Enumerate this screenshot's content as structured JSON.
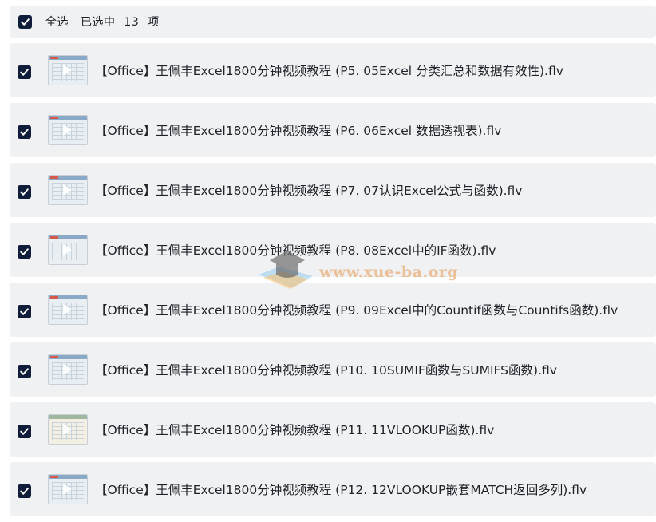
{
  "header": {
    "select_all": "全选",
    "selected_prefix": "已选中",
    "selected_count": "13",
    "selected_suffix": "项"
  },
  "items": [
    {
      "title": "【Office】王佩丰Excel1800分钟视频教程 (P5. 05Excel 分类汇总和数据有效性).flv",
      "checked": true
    },
    {
      "title": "【Office】王佩丰Excel1800分钟视频教程 (P6. 06Excel 数据透视表).flv",
      "checked": true
    },
    {
      "title": "【Office】王佩丰Excel1800分钟视频教程 (P7. 07认识Excel公式与函数).flv",
      "checked": true
    },
    {
      "title": "【Office】王佩丰Excel1800分钟视频教程 (P8. 08Excel中的IF函数).flv",
      "checked": true
    },
    {
      "title": "【Office】王佩丰Excel1800分钟视频教程 (P9. 09Excel中的Countif函数与Countifs函数).flv",
      "checked": true
    },
    {
      "title": "【Office】王佩丰Excel1800分钟视频教程 (P10. 10SUMIF函数与SUMIFS函数).flv",
      "checked": true
    },
    {
      "title": "【Office】王佩丰Excel1800分钟视频教程 (P11. 11VLOOKUP函数).flv",
      "checked": true
    },
    {
      "title": "【Office】王佩丰Excel1800分钟视频教程 (P12. 12VLOOKUP嵌套MATCH返回多列).flv",
      "checked": true
    }
  ],
  "watermark": {
    "text": "www.xue-ba.org"
  },
  "colors": {
    "checkbox": "#0f1c3a",
    "row_bg": "#f0f1f3"
  }
}
